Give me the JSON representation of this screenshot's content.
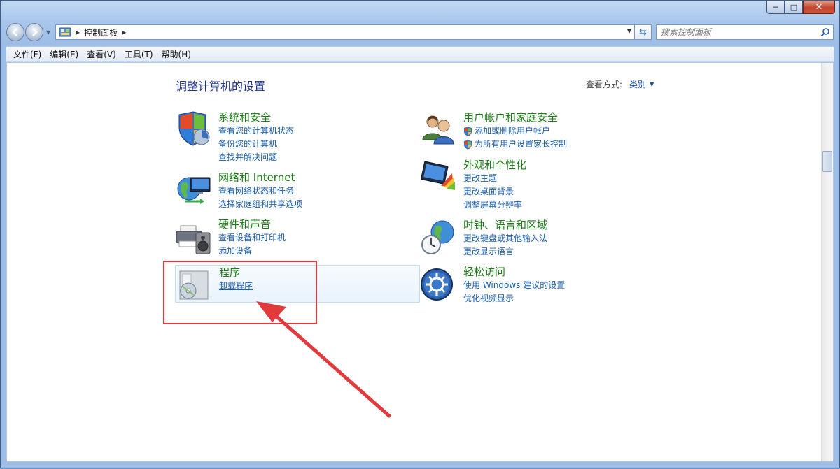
{
  "window": {
    "caption": {
      "minimize": "─",
      "maximize": "□",
      "close": "✕"
    }
  },
  "address": {
    "crumb": "控制面板",
    "search_placeholder": "搜索控制面板"
  },
  "menu": [
    "文件(F)",
    "编辑(E)",
    "查看(V)",
    "工具(T)",
    "帮助(H)"
  ],
  "main": {
    "title": "调整计算机的设置",
    "view_by_label": "查看方式:",
    "view_by_value": "类别"
  },
  "categories": {
    "system": {
      "title": "系统和安全",
      "links": [
        "查看您的计算机状态",
        "备份您的计算机",
        "查找并解决问题"
      ]
    },
    "network": {
      "title": "网络和 Internet",
      "links": [
        "查看网络状态和任务",
        "选择家庭组和共享选项"
      ]
    },
    "hardware": {
      "title": "硬件和声音",
      "links": [
        "查看设备和打印机",
        "添加设备"
      ]
    },
    "programs": {
      "title": "程序",
      "links": [
        "卸载程序"
      ]
    },
    "users": {
      "title": "用户帐户和家庭安全",
      "links": [
        "添加或删除用户帐户",
        "为所有用户设置家长控制"
      ]
    },
    "appearance": {
      "title": "外观和个性化",
      "links": [
        "更改主题",
        "更改桌面背景",
        "调整屏幕分辨率"
      ]
    },
    "clock": {
      "title": "时钟、语言和区域",
      "links": [
        "更改键盘或其他输入法",
        "更改显示语言"
      ]
    },
    "access": {
      "title": "轻松访问",
      "links": [
        "使用 Windows 建议的设置",
        "优化视频显示"
      ]
    }
  },
  "colors": {
    "heading_green": "#1b7c15",
    "link_blue": "#1a5ea8",
    "title_blue": "#1e3287",
    "annotation_red": "#e23a3c"
  }
}
